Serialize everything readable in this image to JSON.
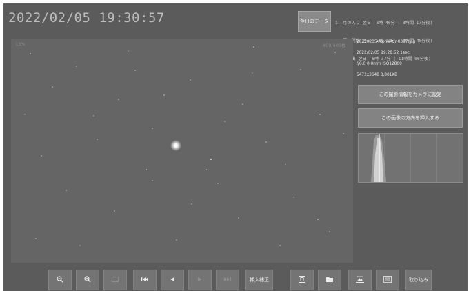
{
  "header": {
    "datetime": "2022/02/05 19:30:57",
    "today_button": "今日のデータ",
    "events": [
      "1: 月の入り 翌日  3時 40分 ( 8時間 17分後)",
      "2: 薄明開始 翌日  5時 11分 ( 9時間 40分後)",
      "3: 日の出 翌日  6時 37分 ( 11時間 06分後)"
    ]
  },
  "viewer": {
    "zoom": "13%",
    "frame_counter": "409/409枚"
  },
  "info": {
    "filename": "20220205-AlphaAur-0367.jpg",
    "shot": "2022/02/05 19:28:52 1sec.",
    "lens": "f/0.0 0.0mm ISO12800",
    "size": "5472x3648 3,801KB"
  },
  "side_buttons": {
    "set_camera": "この撮影情報をカメラに設定",
    "insert_direction": "この画像の方向を挿入する"
  },
  "toolbar": {
    "zoom_out_icon": "magnifier-minus-icon",
    "zoom_in_icon": "magnifier-plus-icon",
    "fit_icon": "fit-screen-icon",
    "first_icon": "skip-first-icon",
    "prev_icon": "previous-icon",
    "next_icon": "next-icon",
    "last_icon": "skip-last-icon",
    "insert_correct": "挿入補正",
    "export_icon": "export-icon",
    "folder_icon": "folder-icon",
    "landscape_icon": "landscape-icon",
    "settings_icon": "list-settings-icon",
    "import": "取り込み"
  },
  "colors": {
    "background": "#5b5b5b",
    "viewer": "#656565",
    "button": "#747474"
  }
}
